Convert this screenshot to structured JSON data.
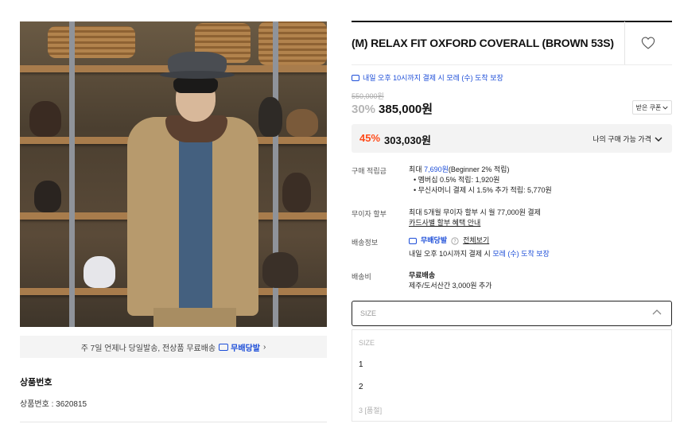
{
  "product": {
    "title": "(M) RELAX FIT OXFORD COVERALL (BROWN 53S)",
    "delivery_notice": "내일 오후 10시까지 결제 시 모레 (수) 도착 보장",
    "original_price": "550,000원",
    "discount_rate": "30%",
    "sale_price": "385,000원",
    "coupon_label": "받은 쿠폰",
    "my_price": {
      "rate": "45%",
      "amount": "303,030원",
      "label": "나의 구매 가능 가격"
    },
    "points": {
      "label": "구매 적립금",
      "prefix": "최대 ",
      "amount": "7,690원",
      "suffix": "(Beginner 2% 적립)",
      "items": [
        "멤버십 0.5% 적립: 1,920원",
        "무신사머니 결제 시 1.5% 추가 적립: 5,770원"
      ]
    },
    "installment": {
      "label": "무이자 할부",
      "text": "최대 5개월 무이자 할부 시 월 77,000원 결제",
      "link": "카드사별 할부 혜택 안내"
    },
    "shipping_info": {
      "label": "배송정보",
      "brand": "무배당발",
      "view_all": "전체보기",
      "note_prefix": "내일 오후 10시까지 결제 시 ",
      "note_highlight": "모레 (수) 도착 보장"
    },
    "shipping_fee": {
      "label": "배송비",
      "title": "무료배송",
      "note": "제주/도서산간 3,000원 추가"
    },
    "size_select": {
      "placeholder": "SIZE",
      "options": [
        {
          "label": "SIZE",
          "disabled": true
        },
        {
          "label": "1",
          "disabled": false
        },
        {
          "label": "2",
          "disabled": false
        },
        {
          "label": "3 [품절]",
          "disabled": true
        }
      ]
    }
  },
  "left": {
    "promo_text": "주 7일 언제나 당일발송, 전상품 무료배송",
    "promo_brand": "무배당발",
    "promo_arrow": "›",
    "product_number_title": "상품번호",
    "product_number": "상품번호 : 3620815"
  },
  "colors": {
    "accent_blue": "#1d4ed8",
    "discount_red": "#ff4b1a"
  }
}
